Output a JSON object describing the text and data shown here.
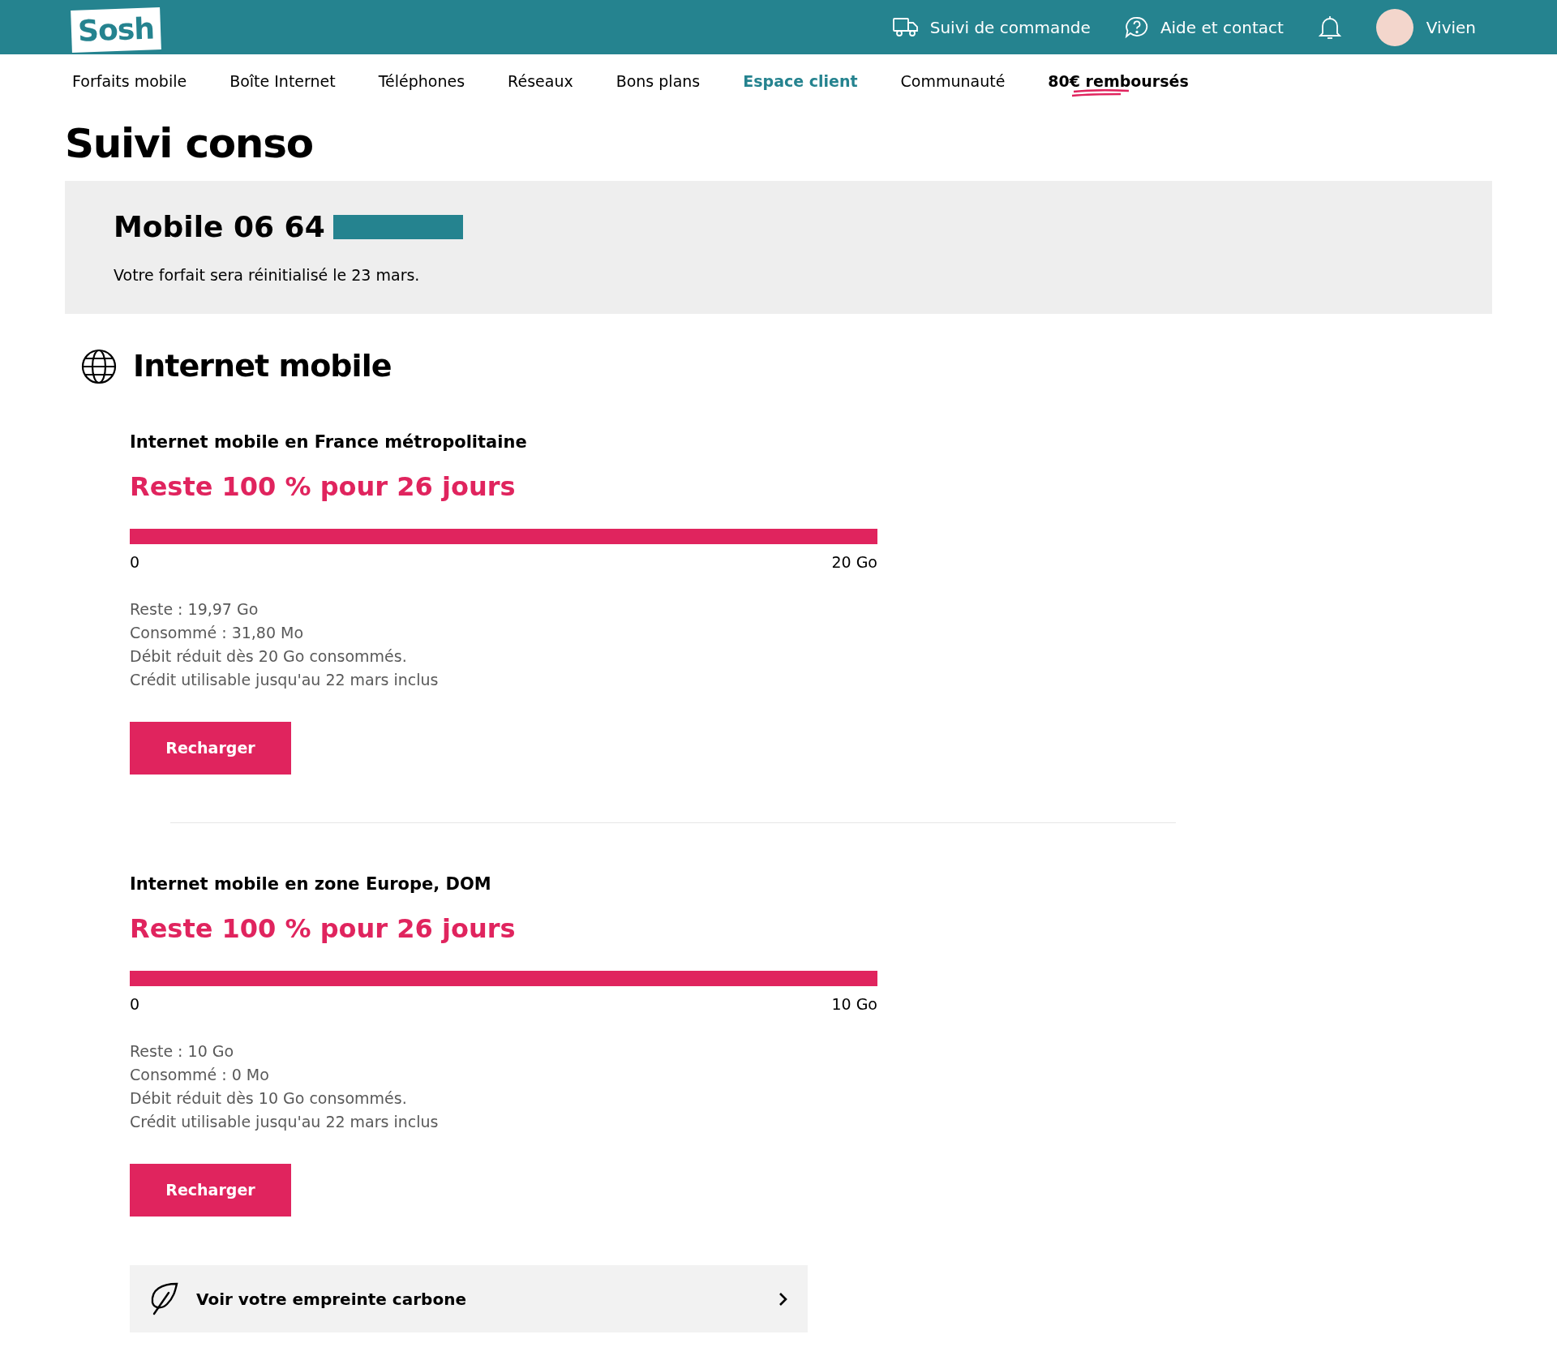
{
  "header": {
    "logo": "Sosh",
    "links": [
      {
        "label": "Suivi de commande",
        "kind": "truck"
      },
      {
        "label": "Aide et contact",
        "kind": "help"
      }
    ],
    "user": "Vivien"
  },
  "nav": [
    {
      "label": "Forfaits mobile",
      "selected": false,
      "kind": "plain"
    },
    {
      "label": "Boîte Internet",
      "selected": false,
      "kind": "plain"
    },
    {
      "label": "Téléphones",
      "selected": false,
      "kind": "plain"
    },
    {
      "label": "Réseaux",
      "selected": false,
      "kind": "plain"
    },
    {
      "label": "Bons plans",
      "selected": false,
      "kind": "plain"
    },
    {
      "label": "Espace client",
      "selected": true,
      "kind": "plain"
    },
    {
      "label": "Communauté",
      "selected": false,
      "kind": "plain"
    },
    {
      "label": "80€ remboursés",
      "selected": false,
      "kind": "promo"
    }
  ],
  "page_title": "Suivi conso",
  "line": {
    "title": "Mobile 06 64",
    "note": "Votre forfait sera réinitialisé le 23 mars."
  },
  "section": {
    "title": "Internet mobile",
    "items": [
      {
        "title": "Internet mobile en France métropolitaine",
        "headline": "Reste 100 % pour 26 jours",
        "level": 1,
        "min": "0",
        "max": "20 Go",
        "details": [
          "Reste : 19,97 Go",
          "Consommé : 31,80 Mo",
          "Débit réduit dès 20 Go consommés.",
          "Crédit utilisable jusqu'au 22 mars inclus"
        ],
        "button": "Recharger"
      },
      {
        "title": "Internet mobile en zone Europe, DOM",
        "headline": "Reste 100 % pour 26 jours",
        "level": 1,
        "min": "0",
        "max": "10 Go",
        "details": [
          "Reste : 10 Go",
          "Consommé : 0 Mo",
          "Débit réduit dès 10 Go consommés.",
          "Crédit utilisable jusqu'au 22 mars inclus"
        ],
        "button": "Recharger"
      }
    ]
  },
  "carbon_link": "Voir votre empreinte carbone"
}
